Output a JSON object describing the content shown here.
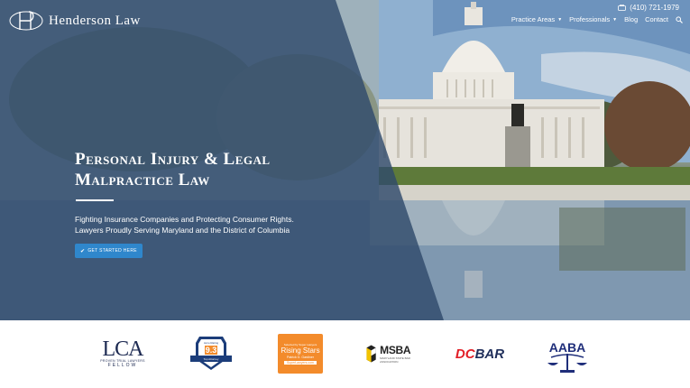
{
  "header": {
    "brand": "Henderson Law",
    "phone": "(410) 721-1979",
    "nav": [
      {
        "label": "Practice Areas",
        "dropdown": true
      },
      {
        "label": "Professionals",
        "dropdown": true
      },
      {
        "label": "Blog",
        "dropdown": false
      },
      {
        "label": "Contact",
        "dropdown": false
      }
    ]
  },
  "hero": {
    "headline_line1": "Personal Injury & Legal",
    "headline_line2": "Malpractice Law",
    "sub_line1": "Fighting Insurance Companies and Protecting Consumer Rights.",
    "sub_line2": "Lawyers Proudly Serving Maryland and the District of Columbia",
    "cta_label": "GET STARTED HERE"
  },
  "badges": {
    "lca_big": "LCA",
    "lca_small": "PROVEN TRIAL LAWYERS",
    "lca_fellow": "FELLOW",
    "avvo_top": "Avvo Rating",
    "avvo_score": "9.3",
    "avvo_bottom": "Top Attorney",
    "rising_tiny": "Selected by Super Lawyers",
    "rising_title": "Rising Stars",
    "rising_name": "Patrick G. Gardiner",
    "rising_site": "SuperLawyers.com",
    "msba": "MSBA",
    "msba_sub": "MARYLAND STATE BAR ASSOCIATION",
    "dc": "DC",
    "bar": "BAR",
    "aaba": "AABA"
  },
  "colors": {
    "accent": "#2f87cc",
    "overlay": "#2f4b6b",
    "rising": "#f38b2b",
    "navy": "#1d2a52"
  }
}
